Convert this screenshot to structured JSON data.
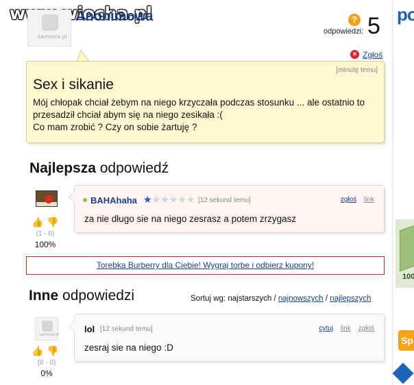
{
  "site": {
    "watermark": "www.wiocha.pl"
  },
  "question": {
    "asker_name": "Anonimowa",
    "avatar_text": "samosia.pl",
    "answers_label": "odpowiedzi:",
    "answers_count": "5",
    "report_label": "Zgłoś",
    "time": "[minutę temu]",
    "title": "Sex i sikanie",
    "body_lines": [
      "Mój chłopak chciał żebym na niego krzyczała podczas stosunku ... ale ostatnio to",
      "przesadził chciał abym się na niego zesikała :(",
      "Co mam zrobić ? Czy on sobie żartuję ?"
    ]
  },
  "best_answer": {
    "section_title_bold": "Najlepsza",
    "section_title_rest": "odpowiedź",
    "answerer": "BAHAhaha",
    "rating": 1,
    "rating_max": 6,
    "time": "[12 sekund temu]",
    "report_label": "zgłoś",
    "link_label": "link",
    "text": "za nie długo sie na niego zesrasz a potem zrzygasz",
    "votes": "(1 - 0)",
    "percent": "100%"
  },
  "ad": {
    "text": "Torebka Burberry dla Ciebie! Wygraj torbe i odbierz kupony!"
  },
  "other_answers": {
    "section_title_bold": "Inne",
    "section_title_rest": "odpowiedzi",
    "sort_label": "Sortuj wg:",
    "sort_current": "najstarszych",
    "sort_options": [
      "najnowszych",
      "najlepszych"
    ],
    "items": [
      {
        "answerer": "lol",
        "time": "[12 sekund temu]",
        "quote_label": "cytuj",
        "link_label": "link",
        "report_label": "zgłoś",
        "text": "zesraj sie na niego :D",
        "votes": "(0 - 0)",
        "percent": "0%",
        "avatar_text": "samosia.pl"
      }
    ]
  },
  "sidebar": {
    "logo": "po",
    "badge_text": "Sp",
    "image_text": "100"
  },
  "colors": {
    "link": "#1a3e8c",
    "question_bg": "#fff8d0",
    "answer_bg": "#fff4f4",
    "ad_border": "#c8282d",
    "accent": "#f0a21b"
  }
}
